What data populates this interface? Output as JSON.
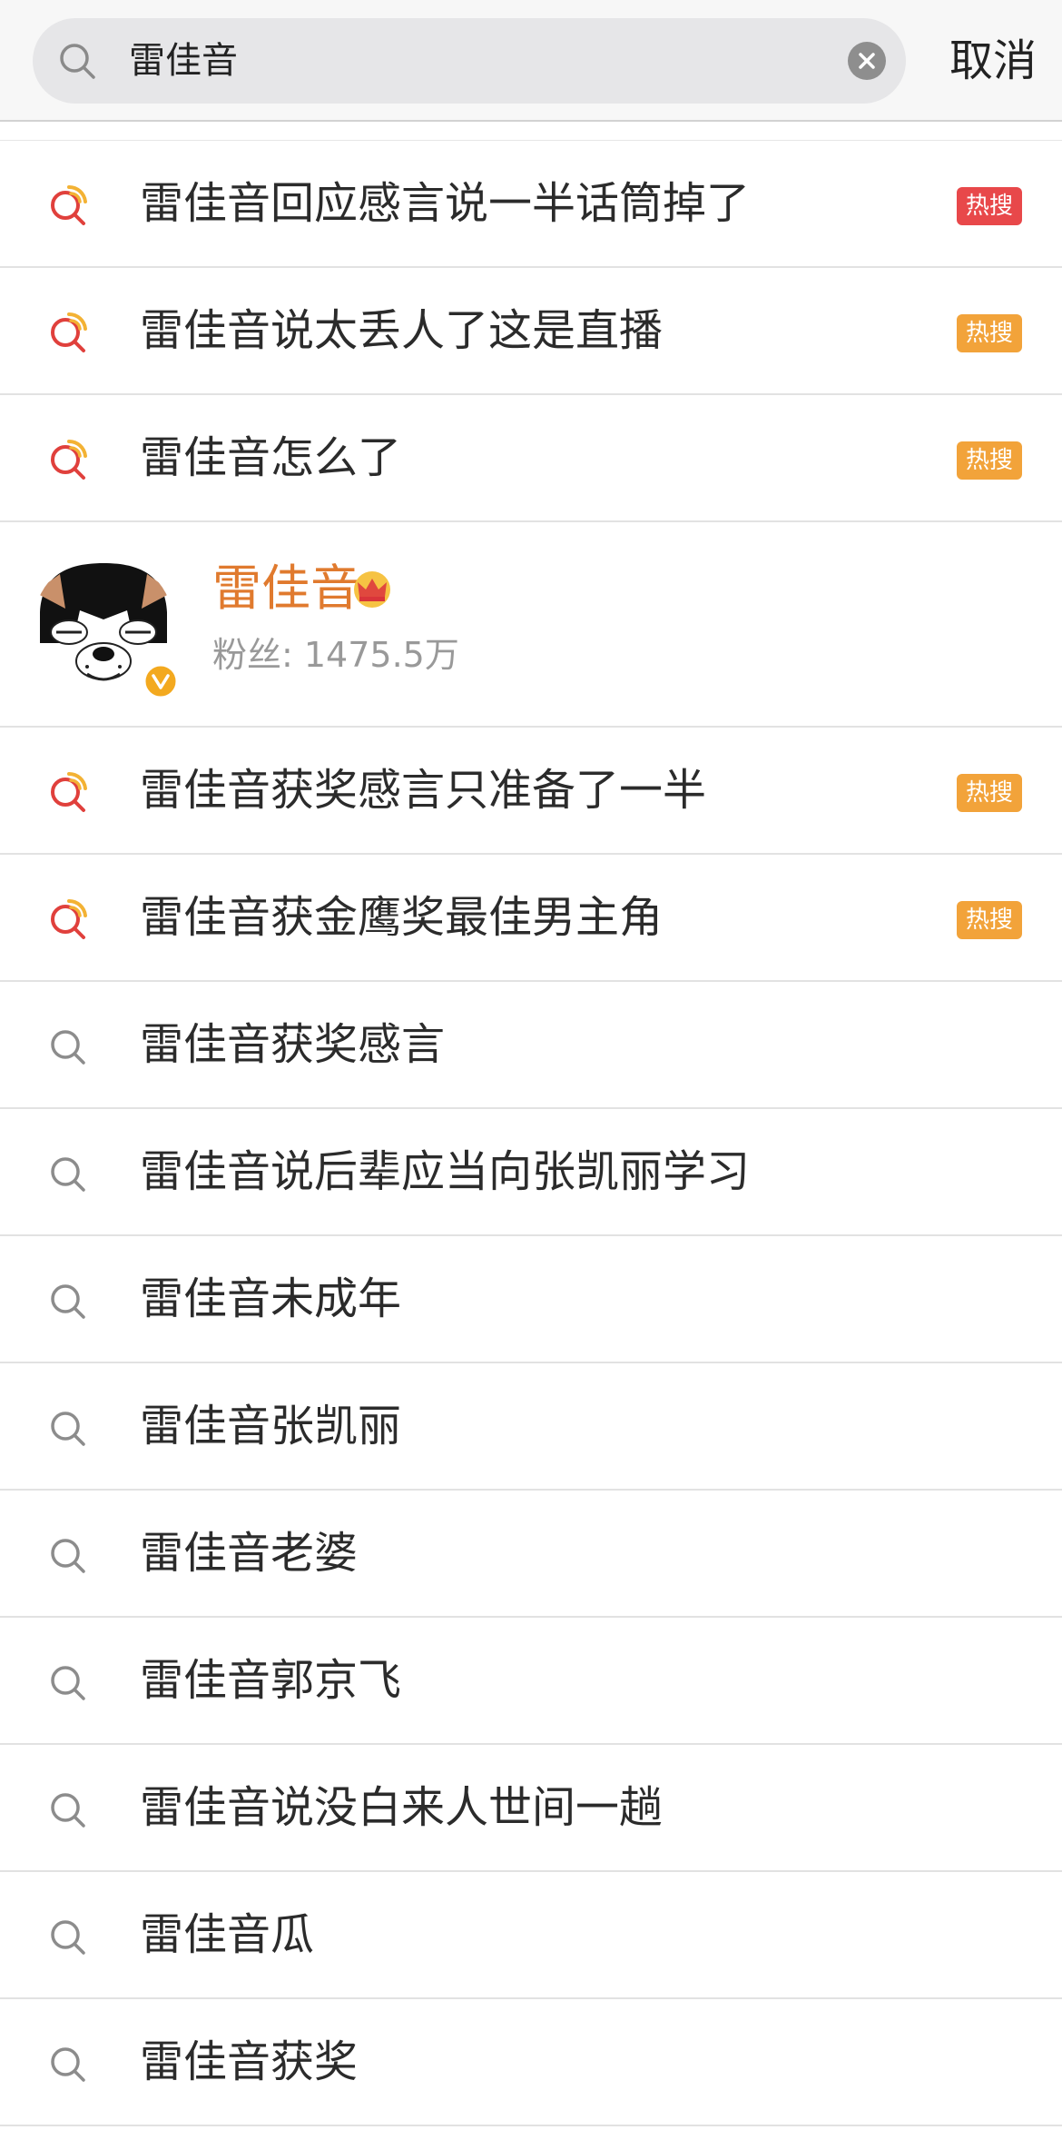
{
  "search": {
    "query": "雷佳音",
    "cancel_label": "取消"
  },
  "suggestions_top": [
    {
      "label": "雷佳音回应感言说一半话筒掉了",
      "badge": "热搜",
      "badge_color": "#e8484a",
      "icon": "hot-search-icon"
    },
    {
      "label": "雷佳音说太丢人了这是直播",
      "badge": "热搜",
      "badge_color": "#f2a33a",
      "icon": "hot-search-icon"
    },
    {
      "label": "雷佳音怎么了",
      "badge": "热搜",
      "badge_color": "#f2a33a",
      "icon": "hot-search-icon"
    }
  ],
  "user": {
    "name": "雷佳音",
    "fans": "粉丝: 1475.5万",
    "verified_icon": "verified-v-icon",
    "crown_icon": "crown-icon"
  },
  "suggestions_bottom": [
    {
      "label": "雷佳音获奖感言只准备了一半",
      "badge": "热搜",
      "badge_color": "#f2a33a",
      "icon": "hot-search-icon"
    },
    {
      "label": "雷佳音获金鹰奖最佳男主角",
      "badge": "热搜",
      "badge_color": "#f2a33a",
      "icon": "hot-search-icon"
    },
    {
      "label": "雷佳音获奖感言",
      "badge": "",
      "icon": "search-icon"
    },
    {
      "label": "雷佳音说后辈应当向张凯丽学习",
      "badge": "",
      "icon": "search-icon"
    },
    {
      "label": "雷佳音未成年",
      "badge": "",
      "icon": "search-icon"
    },
    {
      "label": "雷佳音张凯丽",
      "badge": "",
      "icon": "search-icon"
    },
    {
      "label": "雷佳音老婆",
      "badge": "",
      "icon": "search-icon"
    },
    {
      "label": "雷佳音郭京飞",
      "badge": "",
      "icon": "search-icon"
    },
    {
      "label": "雷佳音说没白来人世间一趟",
      "badge": "",
      "icon": "search-icon"
    },
    {
      "label": "雷佳音瓜",
      "badge": "",
      "icon": "search-icon"
    },
    {
      "label": "雷佳音获奖",
      "badge": "",
      "icon": "search-icon"
    }
  ]
}
